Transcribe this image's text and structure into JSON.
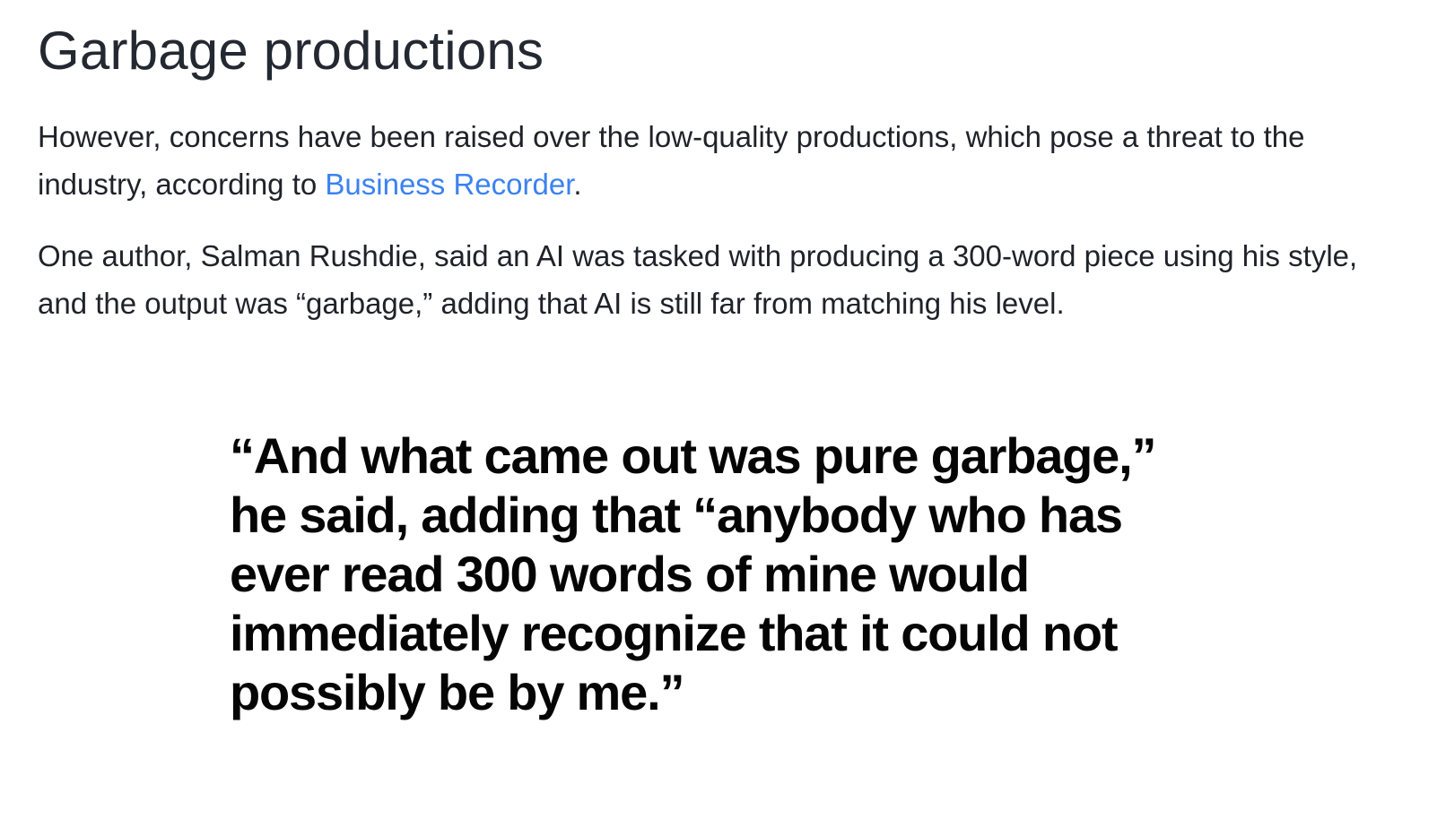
{
  "section": {
    "heading": "Garbage productions"
  },
  "paragraphs": {
    "p1": {
      "before_link": "However, concerns have been raised over the low-quality productions, which pose a threat to the industry, according to ",
      "link_text": "Business Recorder",
      "after_link": "."
    },
    "p2": {
      "text": "One author, Salman Rushdie, said an AI was tasked with producing a 300-word piece using his style, and the output was “garbage,” adding that AI is still far from matching his level."
    }
  },
  "pullquote": {
    "text": "“And what came out was pure garbage,” he said, adding that “anybody who has ever read 300 words of mine would immediately recognize that it could not possibly be by me.”"
  },
  "colors": {
    "link": "#3b82f0",
    "heading": "#232831",
    "body_text": "#1f2229",
    "quote_text": "#050505"
  }
}
